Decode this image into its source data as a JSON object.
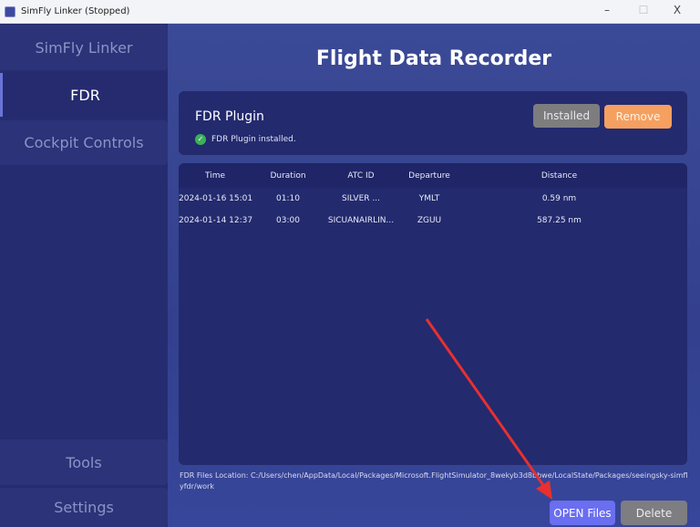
{
  "window": {
    "title": "SimFly Linker (Stopped)",
    "minimize": "–",
    "maximize": "☐",
    "close": "X"
  },
  "sidebar": {
    "items": [
      {
        "label": "SimFly Linker"
      },
      {
        "label": "FDR",
        "active": true
      },
      {
        "label": "Cockpit Controls"
      },
      {
        "label": "Tools"
      },
      {
        "label": "Settings"
      }
    ]
  },
  "main": {
    "title": "Flight Data Recorder",
    "plugin": {
      "title": "FDR Plugin",
      "status": "FDR Plugin installed.",
      "installed_label": "Installed",
      "remove_label": "Remove"
    },
    "table": {
      "columns": [
        "Time",
        "Duration",
        "ATC ID",
        "Departure",
        "Distance"
      ],
      "rows": [
        [
          "2024-01-16 15:01",
          "01:10",
          "SILVER ...",
          "YMLT",
          "0.59 nm"
        ],
        [
          "2024-01-14 12:37",
          "03:00",
          "SICUANAIRLIN...",
          "ZGUU",
          "587.25 nm"
        ]
      ]
    },
    "location": "FDR Files Location: C:/Users/chen/AppData/Local/Packages/Microsoft.FlightSimulator_8wekyb3d8bbwe/LocalState/Packages/seeingsky-simflyfdr/work",
    "open_label": "OPEN Files",
    "delete_label": "Delete"
  },
  "colors": {
    "accent": "#6a6ef0",
    "remove": "#f5a060",
    "installed": "#7d7d80",
    "annotation_arrow": "#e83030"
  }
}
